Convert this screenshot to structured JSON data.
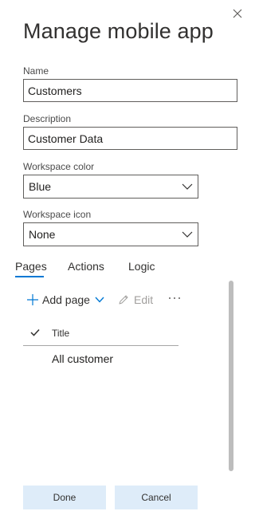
{
  "panel": {
    "title": "Manage mobile app"
  },
  "form": {
    "name": {
      "label": "Name",
      "value": "Customers"
    },
    "description": {
      "label": "Description",
      "value": "Customer Data"
    },
    "workspace_color": {
      "label": "Workspace color",
      "value": "Blue"
    },
    "workspace_icon": {
      "label": "Workspace icon",
      "value": "None"
    }
  },
  "tabs": [
    {
      "label": "Pages",
      "selected": true
    },
    {
      "label": "Actions",
      "selected": false
    },
    {
      "label": "Logic",
      "selected": false
    }
  ],
  "toolbar": {
    "add_label": "Add page",
    "edit_label": "Edit",
    "more_icon": "ellipsis-icon"
  },
  "pages_list": {
    "column_title": "Title",
    "rows": [
      {
        "title": "All customer"
      }
    ]
  },
  "footer": {
    "done_label": "Done",
    "cancel_label": "Cancel"
  },
  "colors": {
    "accent": "#0078d4",
    "button_bg": "#deecf9",
    "disabled_text": "#a19f9d"
  }
}
